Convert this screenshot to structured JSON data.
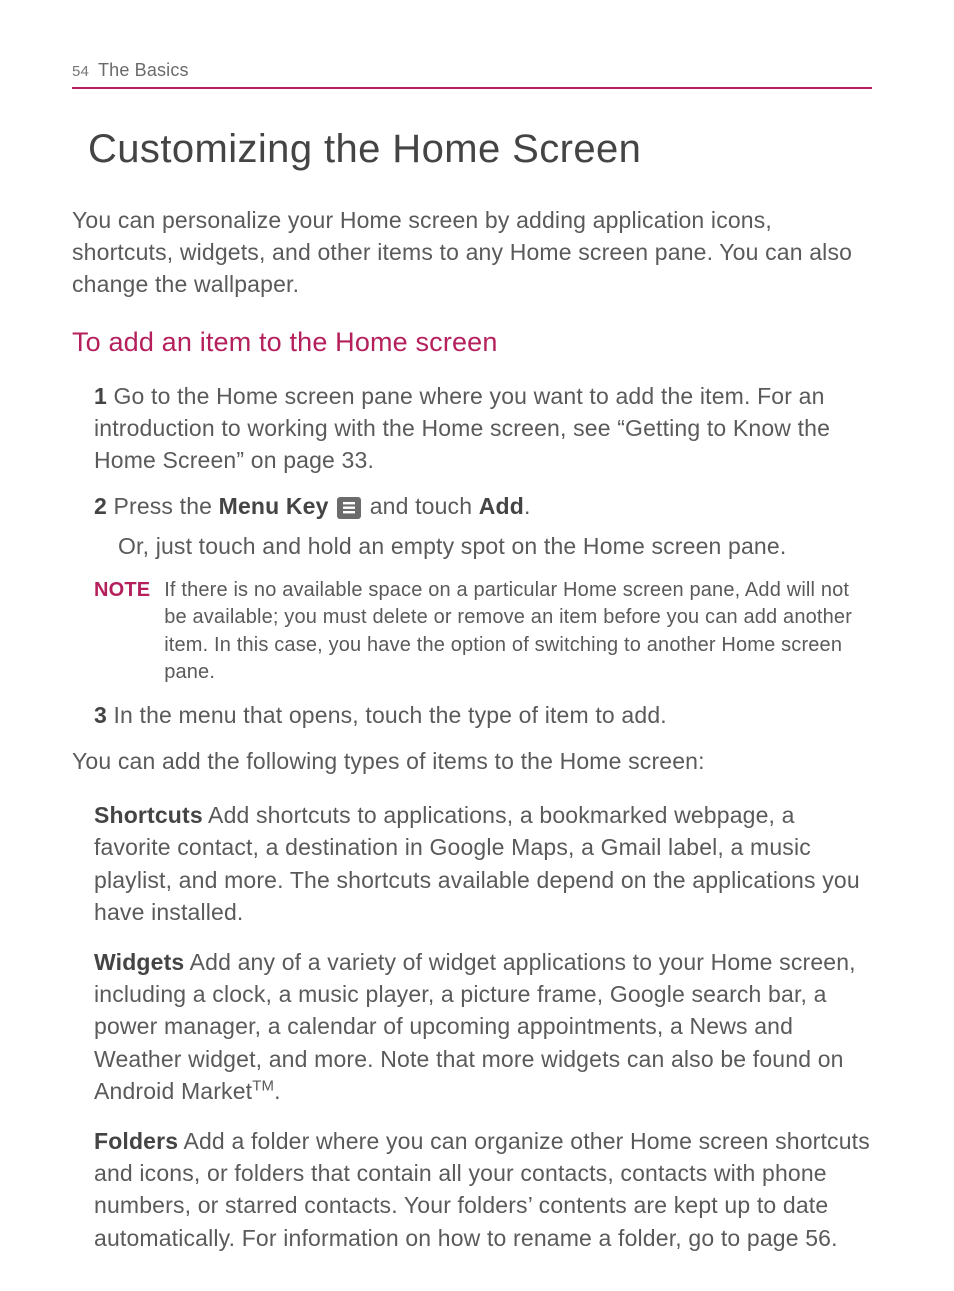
{
  "header": {
    "page_number": "54",
    "section": "The Basics"
  },
  "title": "Customizing the Home Screen",
  "intro": "You can personalize your Home screen by adding application icons, shortcuts, widgets, and other items to any Home screen pane. You can also change the wallpaper.",
  "sub_heading": "To add an item to the Home screen",
  "steps": {
    "s1": {
      "num": "1",
      "text": " Go to the Home screen pane where you want to add the item. For an introduction to working with the Home screen, see “Getting to Know the Home Screen” on page 33."
    },
    "s2": {
      "num": "2",
      "pre": " Press the ",
      "menu_key": "Menu Key",
      "mid": " and touch ",
      "add": "Add",
      "post": ".",
      "line2": "Or, just touch and hold an empty spot on the Home screen pane."
    },
    "note_label": "NOTE",
    "note_text": "If there is no available space on a particular Home screen pane, Add will not be available; you must delete or remove an item before you can add another item. In this case, you have the option of switching to another Home screen pane.",
    "s3": {
      "num": "3",
      "text": " In the menu that opens, touch the type of item to add."
    }
  },
  "lead": "You can add the following types of items to the Home screen:",
  "items": {
    "shortcuts": {
      "label": "Shortcuts",
      "text": "  Add shortcuts to applications, a bookmarked webpage, a favorite contact, a destination in Google Maps, a Gmail label, a music playlist, and more. The shortcuts available depend on the applications you have installed."
    },
    "widgets": {
      "label": "Widgets",
      "text_pre": "  Add any of a variety of widget applications to your Home screen, including a clock, a music player, a picture frame, Google search bar, a power manager, a calendar of upcoming appointments, a News and Weather widget, and more. Note that more widgets can also be found on Android Market",
      "tm": "TM",
      "text_post": "."
    },
    "folders": {
      "label": "Folders",
      "text": "  Add a folder where you can organize other Home screen shortcuts and icons, or folders that contain all your contacts, contacts with phone numbers, or starred contacts. Your folders’ contents are kept up to date automatically. For information on how to rename a folder, go to page 56."
    }
  }
}
